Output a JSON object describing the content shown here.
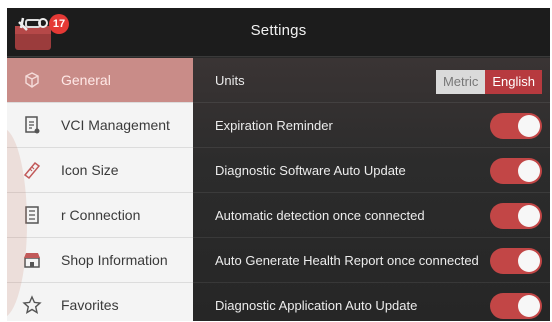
{
  "header": {
    "title": "Settings",
    "badge_count": "17"
  },
  "sidebar": {
    "items": [
      {
        "label": "General",
        "icon": "cube-icon",
        "active": true
      },
      {
        "label": "VCI Management",
        "icon": "document-icon",
        "active": false
      },
      {
        "label": "Icon Size",
        "icon": "ruler-icon",
        "active": false
      },
      {
        "label": "r Connection",
        "icon": "list-icon",
        "active": false
      },
      {
        "label": "Shop Information",
        "icon": "shop-icon",
        "active": false
      },
      {
        "label": "Favorites",
        "icon": "star-icon",
        "active": false
      }
    ]
  },
  "settings": {
    "units": {
      "label": "Units",
      "options": [
        "Metric",
        "English"
      ],
      "selected": "English"
    },
    "rows": [
      {
        "label": "Expiration Reminder",
        "on": true
      },
      {
        "label": "Diagnostic Software Auto Update",
        "on": true
      },
      {
        "label": "Automatic detection once connected",
        "on": true
      },
      {
        "label": "Auto Generate Health Report once connected",
        "on": true
      },
      {
        "label": "Diagnostic Application Auto Update",
        "on": true
      }
    ]
  },
  "colors": {
    "accent": "#c24646",
    "active_sidebar": "#c98c88",
    "header_bg": "#1c1c1c"
  }
}
